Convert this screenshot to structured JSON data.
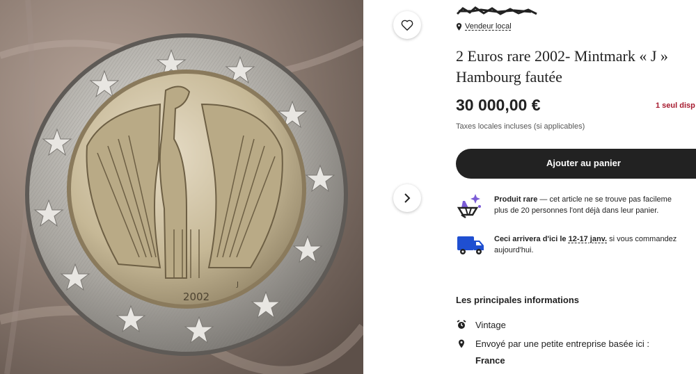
{
  "listing": {
    "image_alt_year": "2002",
    "image_mint_mark": "J",
    "favorite_icon": "heart-icon",
    "next_icon": "chevron-right-icon"
  },
  "seller": {
    "location_label": "Vendeur local",
    "location_icon": "map-pin-icon"
  },
  "product": {
    "title_line1": "2 Euros rare 2002- Mintmark « J »",
    "title_line2": "Hambourg fautée",
    "price": "30 000,00 €",
    "stock_note": "1 seul disp",
    "tax_note": "Taxes locales incluses (si applicables)",
    "add_to_cart": "Ajouter au panier"
  },
  "features": {
    "rare_bold": "Produit rare",
    "rare_text": " — cet article ne se trouve pas facileme",
    "rare_text2": "plus de 20 personnes l'ont déjà dans leur panier.",
    "rare_icon": "sparkle-diamond-icon",
    "delivery_bold": "Ceci arrivera d'ici le ",
    "delivery_date": "12-17 janv.",
    "delivery_text": " si vous commandez",
    "delivery_text2": "aujourd'hui.",
    "delivery_icon": "truck-icon"
  },
  "highlights": {
    "heading": "Les principales informations",
    "items": [
      {
        "icon": "alarm-clock-icon",
        "label": "Vintage"
      },
      {
        "icon": "map-pin-icon",
        "label": "Envoyé par une petite entreprise basée ici :"
      }
    ],
    "country": "France"
  },
  "colors": {
    "accent_dark": "#222222",
    "stock_red": "#a61a2e",
    "truck_blue": "#1f4fd1"
  }
}
